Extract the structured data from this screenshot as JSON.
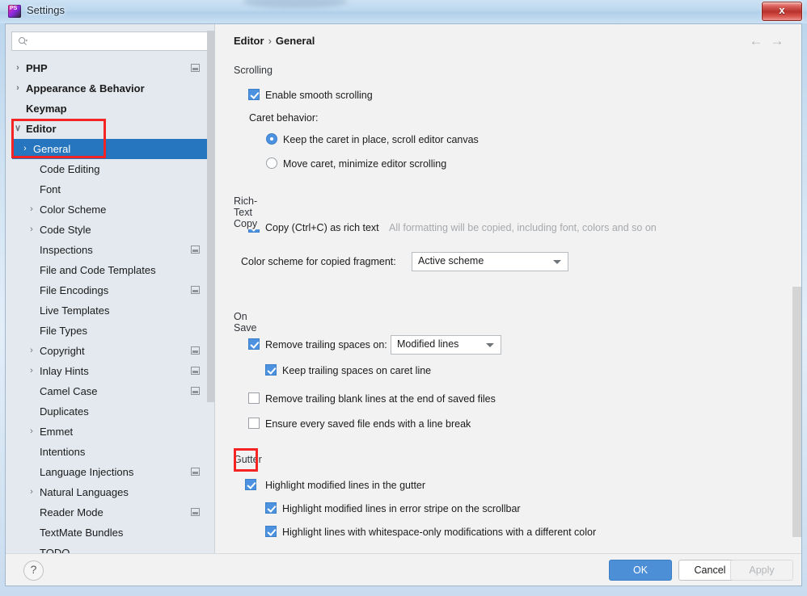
{
  "window": {
    "title": "Settings",
    "app_icon": "phpstorm-icon",
    "close_label": "x"
  },
  "sidebar": {
    "search": {
      "value": "",
      "placeholder": "",
      "icon": "search-icon"
    },
    "items": [
      {
        "label": "PHP",
        "twisty": "›",
        "indent": 9,
        "bold": true,
        "badge": true,
        "selected": false
      },
      {
        "label": "Appearance & Behavior",
        "twisty": "›",
        "indent": 9,
        "bold": true,
        "badge": false,
        "selected": false
      },
      {
        "label": "Keymap",
        "twisty": "",
        "indent": 9,
        "bold": true,
        "badge": false,
        "selected": false
      },
      {
        "label": "Editor",
        "twisty": "∨",
        "indent": 9,
        "bold": true,
        "badge": false,
        "selected": false
      },
      {
        "label": "General",
        "twisty": "›",
        "indent": 26,
        "bold": false,
        "badge": false,
        "selected": true
      },
      {
        "label": "Code Editing",
        "twisty": "",
        "indent": 26,
        "bold": false,
        "badge": false,
        "selected": false
      },
      {
        "label": "Font",
        "twisty": "",
        "indent": 26,
        "bold": false,
        "badge": false,
        "selected": false
      },
      {
        "label": "Color Scheme",
        "twisty": "›",
        "indent": 26,
        "bold": false,
        "badge": false,
        "selected": false
      },
      {
        "label": "Code Style",
        "twisty": "›",
        "indent": 26,
        "bold": false,
        "badge": false,
        "selected": false
      },
      {
        "label": "Inspections",
        "twisty": "",
        "indent": 26,
        "bold": false,
        "badge": true,
        "selected": false
      },
      {
        "label": "File and Code Templates",
        "twisty": "",
        "indent": 26,
        "bold": false,
        "badge": false,
        "selected": false
      },
      {
        "label": "File Encodings",
        "twisty": "",
        "indent": 26,
        "bold": false,
        "badge": true,
        "selected": false
      },
      {
        "label": "Live Templates",
        "twisty": "",
        "indent": 26,
        "bold": false,
        "badge": false,
        "selected": false
      },
      {
        "label": "File Types",
        "twisty": "",
        "indent": 26,
        "bold": false,
        "badge": false,
        "selected": false
      },
      {
        "label": "Copyright",
        "twisty": "›",
        "indent": 26,
        "bold": false,
        "badge": true,
        "selected": false
      },
      {
        "label": "Inlay Hints",
        "twisty": "›",
        "indent": 26,
        "bold": false,
        "badge": true,
        "selected": false
      },
      {
        "label": "Camel Case",
        "twisty": "",
        "indent": 26,
        "bold": false,
        "badge": true,
        "selected": false
      },
      {
        "label": "Duplicates",
        "twisty": "",
        "indent": 26,
        "bold": false,
        "badge": false,
        "selected": false
      },
      {
        "label": "Emmet",
        "twisty": "›",
        "indent": 26,
        "bold": false,
        "badge": false,
        "selected": false
      },
      {
        "label": "Intentions",
        "twisty": "",
        "indent": 26,
        "bold": false,
        "badge": false,
        "selected": false
      },
      {
        "label": "Language Injections",
        "twisty": "",
        "indent": 26,
        "bold": false,
        "badge": true,
        "selected": false
      },
      {
        "label": "Natural Languages",
        "twisty": "›",
        "indent": 26,
        "bold": false,
        "badge": false,
        "selected": false
      },
      {
        "label": "Reader Mode",
        "twisty": "",
        "indent": 26,
        "bold": false,
        "badge": true,
        "selected": false
      },
      {
        "label": "TextMate Bundles",
        "twisty": "",
        "indent": 26,
        "bold": false,
        "badge": false,
        "selected": false
      },
      {
        "label": "TODO",
        "twisty": "",
        "indent": 26,
        "bold": false,
        "badge": false,
        "selected": false
      }
    ]
  },
  "content": {
    "breadcrumb": {
      "parent": "Editor",
      "separator": "›",
      "current": "General"
    },
    "nav": {
      "back_icon": "arrow-left-icon",
      "forward_icon": "arrow-right-icon"
    },
    "groups": {
      "scrolling": {
        "title": "Scrolling",
        "enable_smooth_scrolling": {
          "label": "Enable smooth scrolling",
          "checked": true
        },
        "caret_behavior_label": "Caret behavior:",
        "radio_keep": {
          "label": "Keep the caret in place, scroll editor canvas",
          "selected": true
        },
        "radio_move": {
          "label": "Move caret, minimize editor scrolling",
          "selected": false
        }
      },
      "rich_text_copy": {
        "title": "Rich-Text Copy",
        "copy_as_rich_text": {
          "label": "Copy (Ctrl+C) as rich text",
          "checked": true
        },
        "hint": "All formatting will be copied, including font, colors and so on",
        "scheme_label": "Color scheme for copied fragment:",
        "scheme_value": "Active scheme"
      },
      "on_save": {
        "title": "On Save",
        "remove_trailing_spaces": {
          "label": "Remove trailing spaces on:",
          "checked": true
        },
        "remove_trailing_spaces_value": "Modified lines",
        "keep_trailing_spaces_caret": {
          "label": "Keep trailing spaces on caret line",
          "checked": true
        },
        "remove_trailing_blank_lines": {
          "label": "Remove trailing blank lines at the end of saved files",
          "checked": false
        },
        "ensure_line_break": {
          "label": "Ensure every saved file ends with a line break",
          "checked": false
        }
      },
      "gutter": {
        "title": "Gutter",
        "highlight_modified_gutter": {
          "label": "Highlight modified lines in the gutter",
          "checked": true
        },
        "highlight_error_stripe": {
          "label": "Highlight modified lines in error stripe on the scrollbar",
          "checked": true
        },
        "highlight_whitespace_only": {
          "label": "Highlight lines with whitespace-only modifications with a different color",
          "checked": true
        }
      }
    }
  },
  "footer": {
    "help_label": "?",
    "ok_label": "OK",
    "cancel_label": "Cancel",
    "apply_label": "Apply"
  },
  "annotations": {
    "accent_color": "#f42424",
    "tree_highlight_target": "Editor > General",
    "checkbox_highlight_target": "Highlight modified lines in the gutter"
  }
}
